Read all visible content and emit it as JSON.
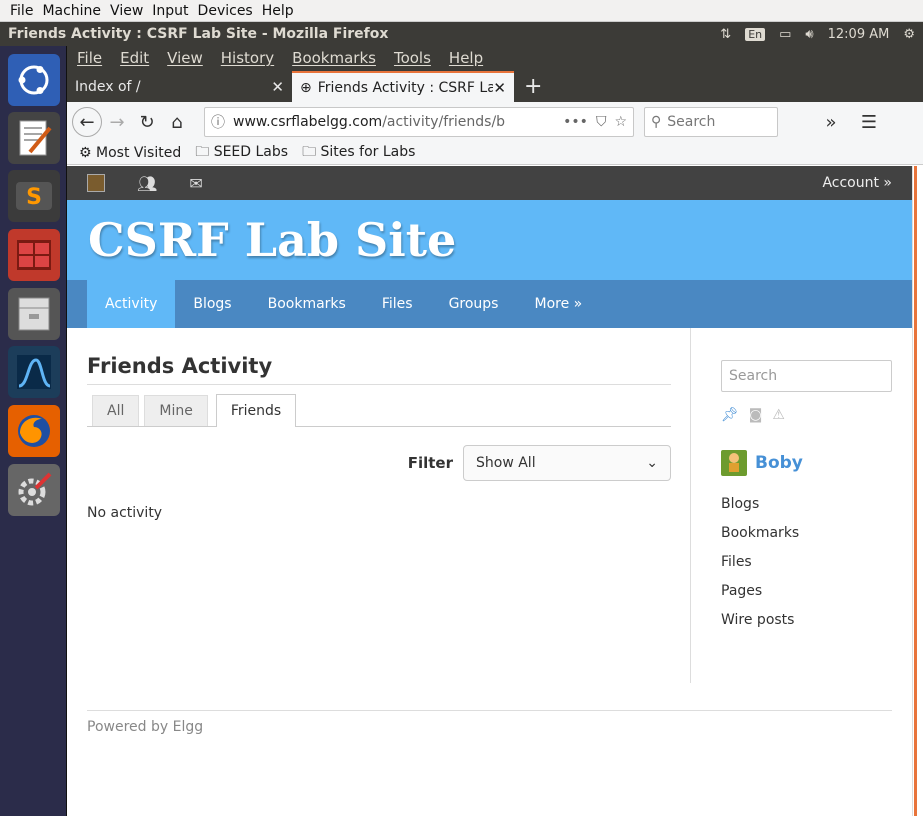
{
  "vm_menu": [
    "File",
    "Machine",
    "View",
    "Input",
    "Devices",
    "Help"
  ],
  "os_topbar": {
    "window_title": "Friends Activity : CSRF Lab Site - Mozilla Firefox",
    "lang": "En",
    "clock": "12:09 AM"
  },
  "launcher": [
    "ubuntu-dash-icon",
    "text-editor-icon",
    "sublime-text-icon",
    "terminal-icon",
    "file-manager-icon",
    "wireshark-icon",
    "firefox-icon",
    "system-settings-icon"
  ],
  "firefox_menu": [
    "File",
    "Edit",
    "View",
    "History",
    "Bookmarks",
    "Tools",
    "Help"
  ],
  "tabs": {
    "inactive": "Index of /",
    "active": "Friends Activity : CSRF La",
    "close": "✕",
    "new": "+"
  },
  "url": {
    "host": "www.csrflabelgg.com",
    "path": "/activity/friends/b",
    "more": "•••"
  },
  "search_placeholder": "Search",
  "bookmarks": [
    "Most Visited",
    "SEED Labs",
    "Sites for Labs"
  ],
  "site": {
    "account": "Account »",
    "title": "CSRF Lab Site",
    "nav": [
      "Activity",
      "Blogs",
      "Bookmarks",
      "Files",
      "Groups",
      "More »"
    ],
    "heading": "Friends Activity",
    "page_tabs": [
      "All",
      "Mine",
      "Friends"
    ],
    "filter_label": "Filter",
    "filter_value": "Show All",
    "no_activity": "No activity",
    "sidebar_search_placeholder": "Search",
    "owner": "Boby",
    "owner_links": [
      "Blogs",
      "Bookmarks",
      "Files",
      "Pages",
      "Wire posts"
    ],
    "footer": "Powered by Elgg"
  },
  "colors": {
    "header": "#60b8f7",
    "nav": "#4a88c2",
    "topbar": "#424242",
    "link": "#4690d6"
  }
}
